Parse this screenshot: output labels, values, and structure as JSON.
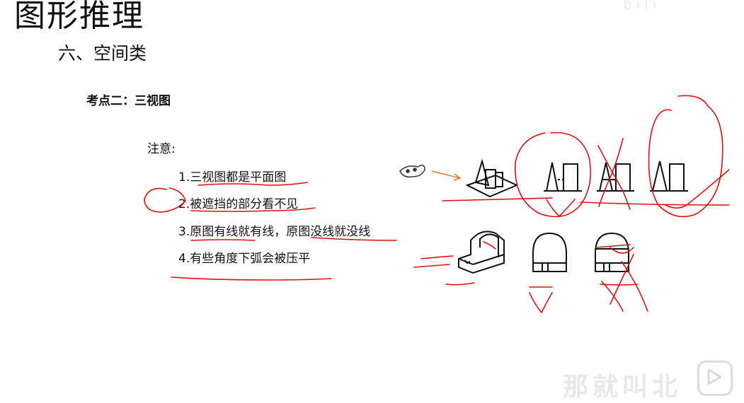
{
  "slide": {
    "title": "图形推理",
    "subtitle": "六、空间类",
    "key_point": "考点二：三视图",
    "note_label": "注意:",
    "items": [
      "1.三视图都是平面图",
      "2.被遮挡的部分看不见",
      "3.原图有线就有线，原图没线就没线",
      "4.有些角度下弧会被压平"
    ]
  },
  "overlay": {
    "watermark_top": "bili",
    "watermark_bottom": "那就叫北",
    "annotation_color": "#e01010",
    "arrow_color": "#e07a30"
  }
}
